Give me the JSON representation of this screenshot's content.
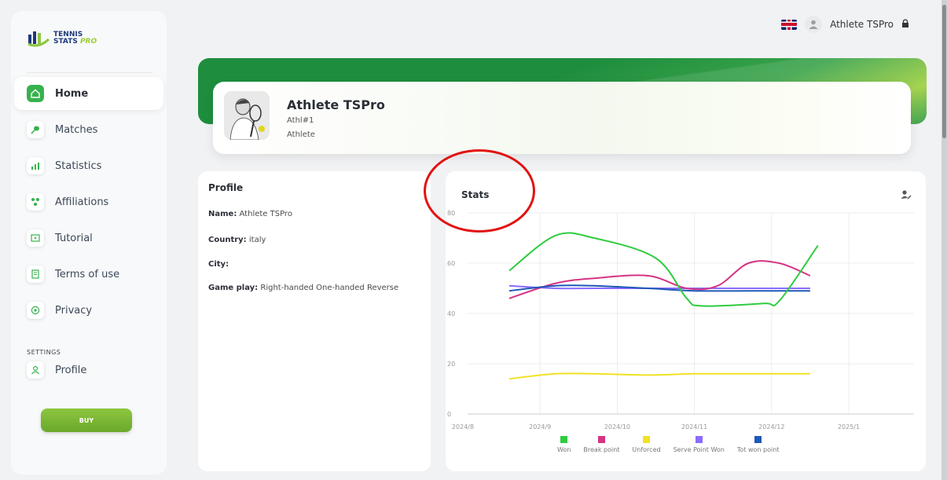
{
  "logo": {
    "line1": "TENNIS",
    "line2": "STATS",
    "line3": "PRO"
  },
  "sidebar": {
    "items": [
      {
        "label": "Home",
        "icon": "home-icon",
        "active": true
      },
      {
        "label": "Matches",
        "icon": "racket-icon"
      },
      {
        "label": "Statistics",
        "icon": "chart-icon"
      },
      {
        "label": "Affiliations",
        "icon": "affiliations-icon"
      },
      {
        "label": "Tutorial",
        "icon": "tutorial-icon"
      },
      {
        "label": "Terms of use",
        "icon": "terms-icon"
      },
      {
        "label": "Privacy",
        "icon": "privacy-icon"
      }
    ],
    "settings_label": "SETTINGS",
    "profile_item": {
      "label": "Profile",
      "icon": "user-icon"
    },
    "buy_label": "BUY"
  },
  "header": {
    "username": "Athlete TSPro",
    "flag": "uk-flag-icon",
    "lock": "lock-icon"
  },
  "athlete": {
    "name": "Athlete TSPro",
    "id": "Athl#1",
    "role": "Athlete"
  },
  "profile": {
    "title": "Profile",
    "name_key": "Name:",
    "name_value": "Athlete TSPro",
    "country_key": "Country:",
    "country_value": "italy",
    "city_key": "City:",
    "city_value": "",
    "gameplay_key": "Game play:",
    "gameplay_value": "Right-handed One-handed Reverse"
  },
  "stats": {
    "title": "Stats"
  },
  "colors": {
    "accent": "#37b24d",
    "won": "#2ecc40",
    "break": "#d63384",
    "unforced": "#f2e125",
    "serve": "#8a6cff",
    "tot": "#1e58b8"
  },
  "chart_data": {
    "type": "line",
    "x": [
      "2024/8",
      "2024/9",
      "2024/10",
      "2024/11",
      "2024/12",
      "2025/1"
    ],
    "ylim": [
      0,
      80
    ],
    "yticks": [
      0,
      20,
      40,
      60,
      80
    ],
    "series": [
      {
        "name": "Won",
        "color": "#2ecc40",
        "points": [
          [
            8.6,
            57
          ],
          [
            9.2,
            71
          ],
          [
            9.7,
            70
          ],
          [
            10.5,
            62
          ],
          [
            10.9,
            46
          ],
          [
            11.1,
            43
          ],
          [
            11.9,
            44
          ],
          [
            12.1,
            45
          ],
          [
            12.6,
            67
          ]
        ]
      },
      {
        "name": "Break point",
        "color": "#d63384",
        "points": [
          [
            8.6,
            46
          ],
          [
            9.2,
            52
          ],
          [
            9.7,
            54
          ],
          [
            10.4,
            55
          ],
          [
            10.9,
            50
          ],
          [
            11.3,
            51
          ],
          [
            11.7,
            60
          ],
          [
            12.1,
            60
          ],
          [
            12.5,
            55
          ]
        ]
      },
      {
        "name": "Unforced",
        "color": "#f2e125",
        "points": [
          [
            8.6,
            14
          ],
          [
            9.2,
            16
          ],
          [
            9.7,
            16
          ],
          [
            10.4,
            15.5
          ],
          [
            11.0,
            16
          ],
          [
            11.7,
            16
          ],
          [
            12.1,
            16
          ],
          [
            12.5,
            16
          ]
        ]
      },
      {
        "name": "Serve Point Won",
        "color": "#8a6cff",
        "points": [
          [
            8.6,
            51
          ],
          [
            9.2,
            50
          ],
          [
            9.7,
            50
          ],
          [
            10.4,
            50
          ],
          [
            11.0,
            50
          ],
          [
            11.7,
            50
          ],
          [
            12.5,
            50
          ]
        ]
      },
      {
        "name": "Tot won point",
        "color": "#1e58b8",
        "points": [
          [
            8.6,
            49
          ],
          [
            9.2,
            51
          ],
          [
            9.7,
            51
          ],
          [
            10.4,
            50
          ],
          [
            11.0,
            49
          ],
          [
            11.7,
            49
          ],
          [
            12.5,
            49
          ]
        ]
      }
    ]
  }
}
